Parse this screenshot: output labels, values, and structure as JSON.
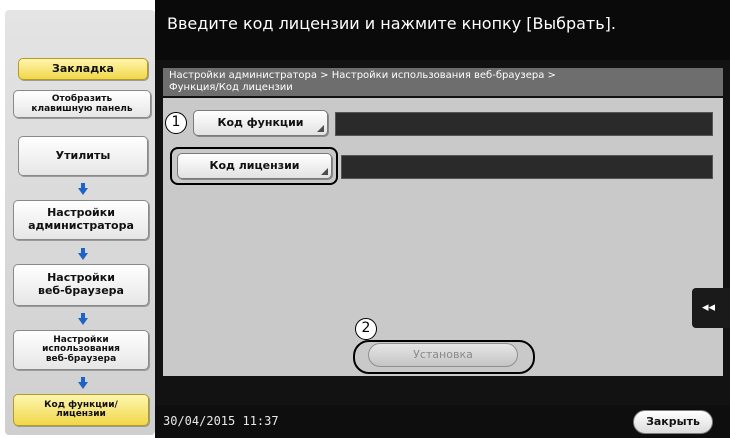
{
  "header": {
    "title": "Введите код лицензии и нажмите кнопку [Выбрать]."
  },
  "sidebar": {
    "bookmark_label": "Закладка",
    "keypad_label": [
      "Отобразить",
      "клавишную панель"
    ],
    "steps": [
      {
        "lines": [
          "Утилиты"
        ]
      },
      {
        "lines": [
          "Настройки",
          "администратора"
        ]
      },
      {
        "lines": [
          "Настройки",
          "веб-браузера"
        ]
      },
      {
        "lines": [
          "Настройки",
          "использования",
          "веб-браузера"
        ]
      },
      {
        "lines": [
          "Код функции/",
          "лицензии"
        ]
      }
    ]
  },
  "breadcrumb": {
    "line1": "Настройки администратора > Настройки использования веб-браузера >",
    "line2": "Функция/Код лицензии"
  },
  "form": {
    "function_code_label": "Код функции",
    "function_code_value": "",
    "license_code_label": "Код лицензии",
    "license_code_value": ""
  },
  "callouts": {
    "one": "1",
    "two": "2"
  },
  "actions": {
    "install_label": "Установка",
    "close_label": "Закрыть"
  },
  "status": {
    "datetime": "30/04/2015  11:37"
  },
  "side_tab": {
    "icon": "double-chevron-left-icon",
    "glyph": "◂◂"
  }
}
